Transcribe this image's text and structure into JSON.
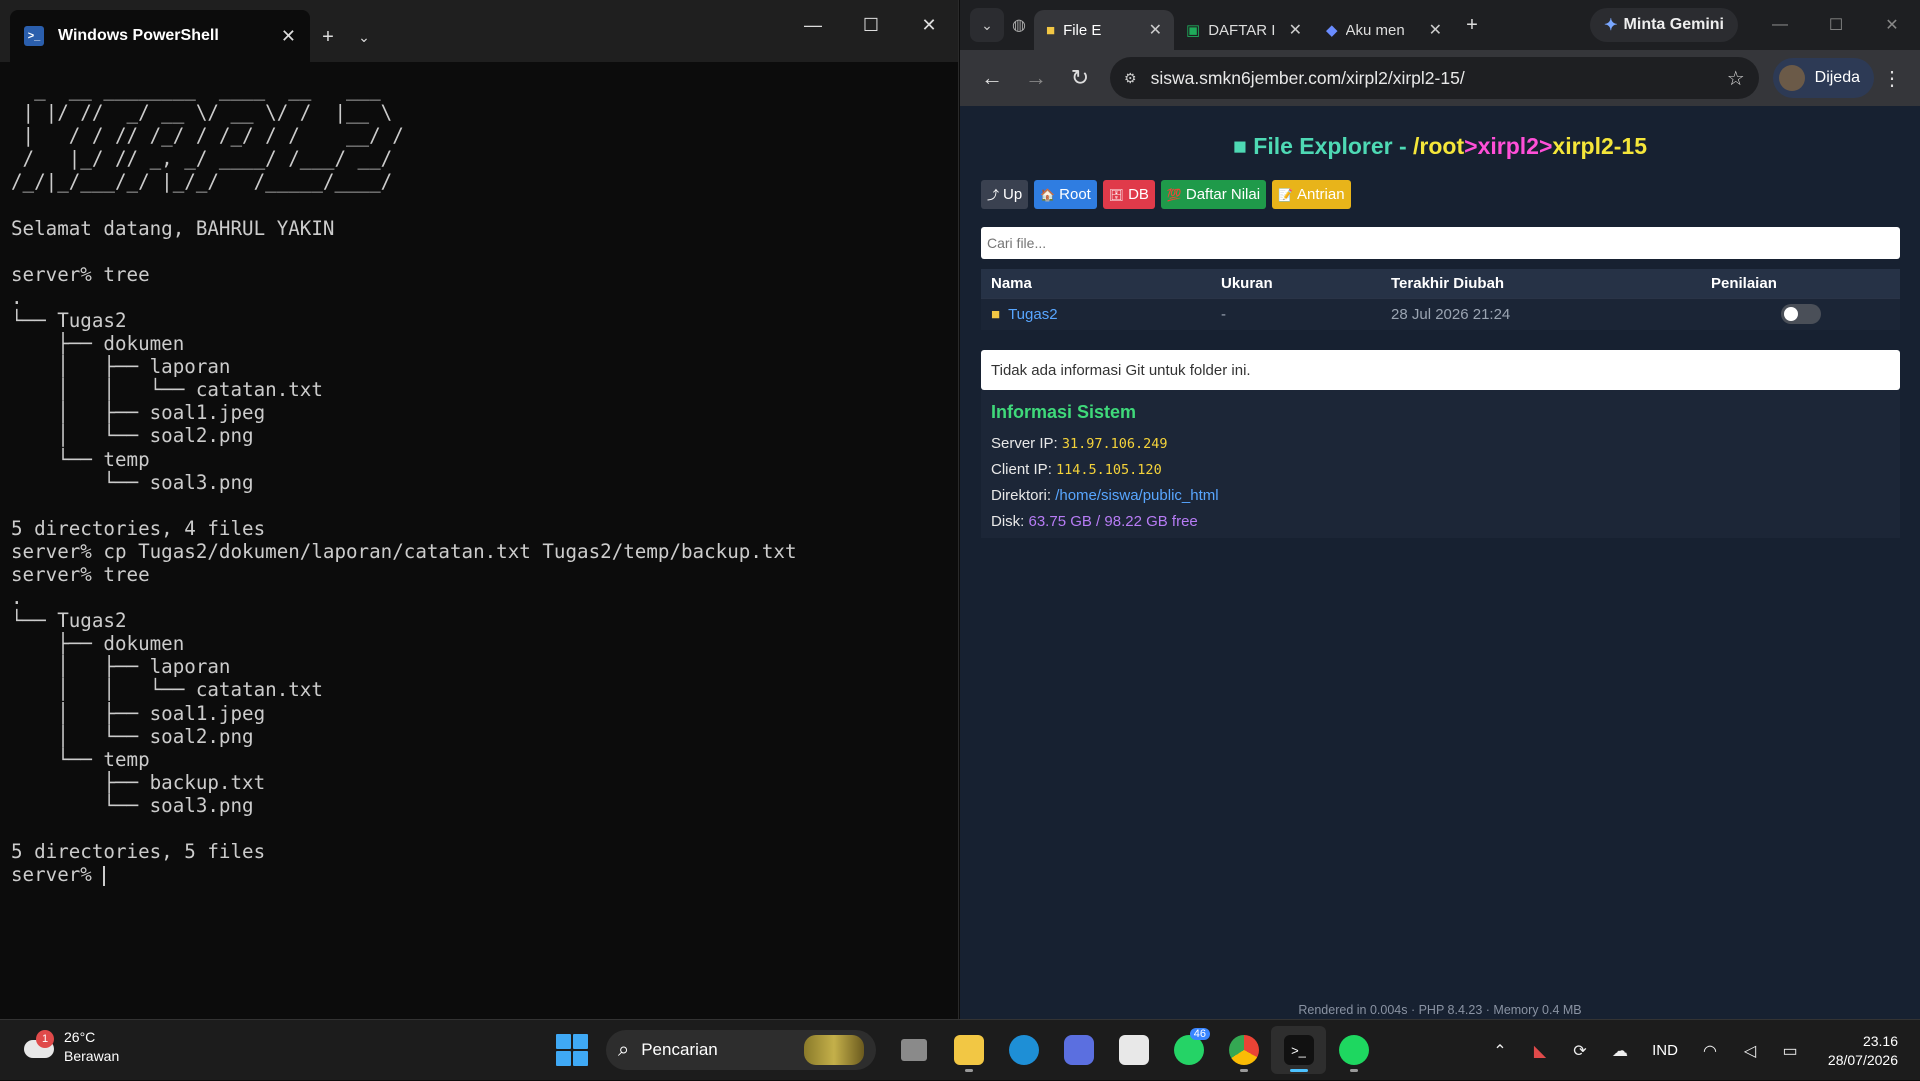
{
  "terminal": {
    "tab_title": "Windows PowerShell",
    "lines": [
      "  _  __ ________  ____  __   ___",
      " | |/ //  _/ __ \\/ __ \\/ /  |__ \\",
      " |   / / // /_/ / /_/ / /    __/ /",
      " /   |_/ // _, _/ ____/ /___/ __/",
      "/_/|_/___/_/ |_/_/   /_____/____/",
      "",
      "Selamat datang, BAHRUL YAKIN",
      "",
      "server% tree",
      ".",
      "└── Tugas2",
      "    ├── dokumen",
      "    │   ├── laporan",
      "    │   │   └── catatan.txt",
      "    │   ├── soal1.jpeg",
      "    │   └── soal2.png",
      "    └── temp",
      "        └── soal3.png",
      "",
      "5 directories, 4 files",
      "server% cp Tugas2/dokumen/laporan/catatan.txt Tugas2/temp/backup.txt",
      "server% tree",
      ".",
      "└── Tugas2",
      "    ├── dokumen",
      "    │   ├── laporan",
      "    │   │   └── catatan.txt",
      "    │   ├── soal1.jpeg",
      "    │   └── soal2.png",
      "    └── temp",
      "        ├── backup.txt",
      "        └── soal3.png",
      "",
      "5 directories, 5 files"
    ],
    "prompt": "server% "
  },
  "browser": {
    "tabs": [
      {
        "label": "File E"
      },
      {
        "label": "DAFTAR I"
      },
      {
        "label": "Aku men"
      }
    ],
    "gemini_label": "Minta Gemini",
    "url": "siswa.smkn6jember.com/xirpl2/xirpl2-15/",
    "profile_name": "Dijeda"
  },
  "page": {
    "title_prefix": "File Explorer - ",
    "path_root": "/root",
    "path_sep1": ">",
    "path_part1": "xirpl2",
    "path_sep2": ">",
    "path_part2": "xirpl2-15",
    "buttons": [
      {
        "label": "Up",
        "icon": "⤴",
        "color": "#3a4150"
      },
      {
        "label": "Root",
        "icon": "🏠",
        "color": "#2f7de1"
      },
      {
        "label": "DB",
        "icon": "🗄",
        "color": "#e03a4a"
      },
      {
        "label": "Daftar Nilai",
        "icon": "💯",
        "color": "#1f9a4a"
      },
      {
        "label": "Antrian",
        "icon": "📝",
        "color": "#e8b41a"
      }
    ],
    "search_placeholder": "Cari file...",
    "table": {
      "headers": [
        "Nama",
        "Ukuran",
        "Terakhir Diubah",
        "Penilaian"
      ],
      "rows": [
        {
          "name": "Tugas2",
          "size": "-",
          "modified": "28 Jul 2026 21:24",
          "toggle": false
        }
      ]
    },
    "git_info": "Tidak ada informasi Git untuk folder ini.",
    "sysinfo": {
      "title": "Informasi Sistem",
      "server_ip_label": "Server IP: ",
      "server_ip": "31.97.106.249",
      "client_ip_label": "Client IP: ",
      "client_ip": "114.5.105.120",
      "dir_label": "Direktori: ",
      "dir": "/home/siswa/public_html",
      "disk_label": "Disk: ",
      "disk": "63.75 GB / 98.22 GB free"
    },
    "footer": "Rendered in 0.004s · PHP 8.4.23 · Memory 0.4 MB"
  },
  "taskbar": {
    "temp": "26°C",
    "weather": "Berawan",
    "weather_badge": "1",
    "search_label": "Pencarian",
    "whatsapp_badge": "46",
    "lang": "IND",
    "time": "23.16",
    "date": "28/07/2026"
  }
}
